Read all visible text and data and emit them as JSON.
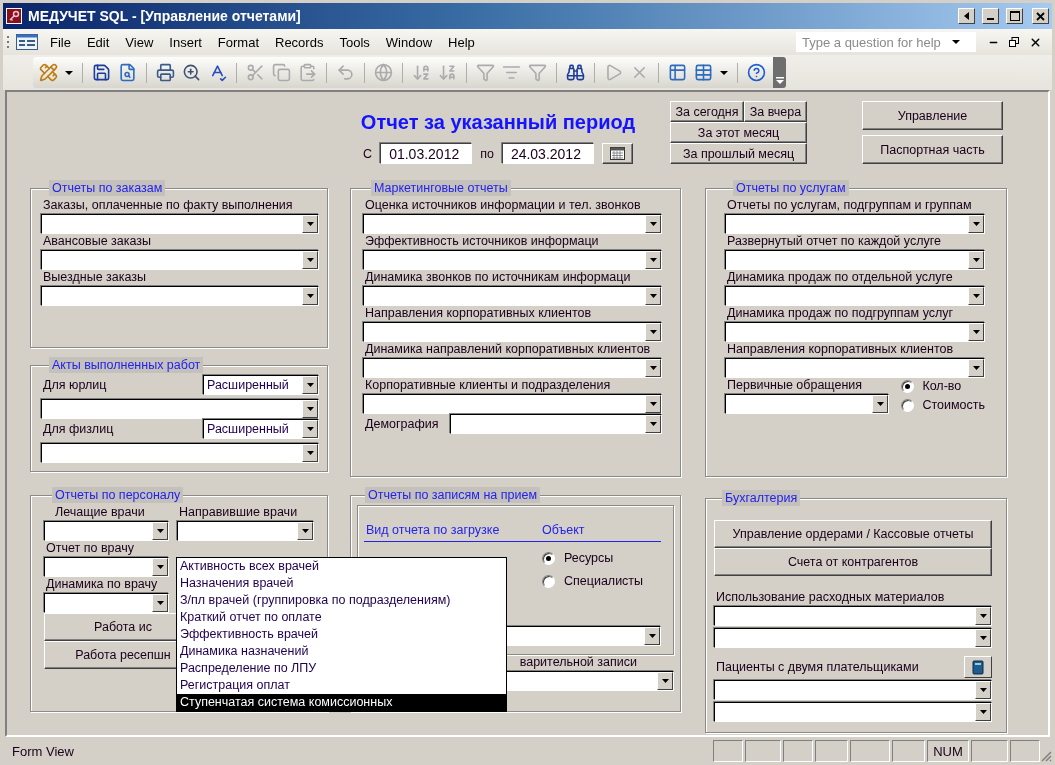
{
  "window": {
    "title": "МЕДУЧЕТ SQL - [Управление отчетами]"
  },
  "menu": [
    "File",
    "Edit",
    "View",
    "Insert",
    "Format",
    "Records",
    "Tools",
    "Window",
    "Help"
  ],
  "help_box": {
    "placeholder": "Type a question for help"
  },
  "toolbar": [
    {
      "disabled": false
    },
    {
      "disabled": false
    },
    {
      "disabled": false
    },
    {
      "disabled": false
    },
    {
      "disabled": false
    },
    {
      "disabled": false
    },
    {
      "disabled": true
    },
    {
      "disabled": true
    },
    {
      "disabled": true
    },
    {
      "disabled": true
    },
    {
      "disabled": true
    },
    {
      "disabled": true
    },
    {
      "disabled": true
    },
    {
      "disabled": true
    },
    {
      "disabled": true
    },
    {
      "disabled": true
    },
    {
      "disabled": false
    },
    {
      "disabled": true
    },
    {
      "disabled": true
    },
    {
      "disabled": false
    },
    {
      "disabled": false
    },
    {
      "disabled": false
    }
  ],
  "form": {
    "title": "Отчет за указанный период",
    "period": {
      "from_label": "С",
      "from": "01.03.2012",
      "to_label": "по",
      "to": "24.03.2012"
    },
    "quick_buttons": [
      "За сегодня",
      "За вчера",
      "За этот месяц",
      "За прошлый месяц"
    ],
    "side_buttons": [
      "Управление",
      "Паспортная часть"
    ],
    "columns": [
      [
        {
          "title": "Отчеты по заказам",
          "items": [
            {
              "kind": "field",
              "label": "Заказы, оплаченные по факту выполнения"
            },
            {
              "kind": "field",
              "label": "Авансовые заказы"
            },
            {
              "kind": "field",
              "label": "Выездные заказы"
            }
          ]
        },
        {
          "title": "Акты выполненных работ",
          "items": [
            {
              "kind": "option_field",
              "label": "Для юрлиц",
              "value": "Расширенный"
            },
            {
              "kind": "option_field",
              "label": "Для физлиц",
              "value": "Расширенный"
            }
          ]
        },
        {
          "title": "Отчеты по персоналу",
          "items": [
            {
              "kind": "pair",
              "fields": [
                {
                  "label": "Лечащие врачи"
                },
                {
                  "label": "Направившие врачи"
                }
              ]
            },
            {
              "kind": "short_field",
              "label": "Отчет по врачу"
            },
            {
              "kind": "short_field",
              "label": "Динамика по врачу"
            },
            {
              "kind": "buttons",
              "labels": [
                "Работа ис",
                "Работа ресепшн"
              ]
            }
          ]
        }
      ],
      [
        {
          "title": "Маркетинговые отчеты",
          "items": [
            {
              "kind": "field",
              "label": "Оценка источников информации и тел. звонков"
            },
            {
              "kind": "field",
              "label": "Эффективность источников информаци"
            },
            {
              "kind": "field",
              "label": "Динамика звонков по источникам информаци"
            },
            {
              "kind": "field",
              "label": "Направления корпоративных клиентов"
            },
            {
              "kind": "field",
              "label": "Динамика направлений корпоративных клиентов"
            },
            {
              "kind": "field",
              "label": "Корпоративные клиенты и подразделения"
            },
            {
              "kind": "inline_field",
              "label": "Демография"
            }
          ]
        },
        {
          "title": "Отчеты по записям на прием",
          "items": [
            {
              "kind": "radio_box",
              "columns": [
                {
                  "header": "Вид отчета по загрузке"
                },
                {
                  "header": "Объект",
                  "options": [
                    {
                      "label": "Ресурсы",
                      "selected": true
                    },
                    {
                      "label": "Специалисты",
                      "selected": false
                    }
                  ]
                }
              ]
            },
            {
              "kind": "field_right",
              "label": "варительной записи"
            }
          ]
        }
      ],
      [
        {
          "title": "Отчеты по услугам",
          "items": [
            {
              "kind": "field",
              "label": "Отчеты по услугам, подгруппам и группам"
            },
            {
              "kind": "field",
              "label": "Развернутый отчет по каждой услуге"
            },
            {
              "kind": "field",
              "label": "Динамика продаж по отдельной услуге"
            },
            {
              "kind": "field",
              "label": "Динамика продаж по подгруппам услуг"
            },
            {
              "kind": "field",
              "label": "Направления корпоративных клиентов"
            },
            {
              "kind": "radio_field",
              "label": "Первичные обращения",
              "options": [
                {
                  "label": "Кол-во",
                  "selected": true
                },
                {
                  "label": "Стоимость",
                  "selected": false
                }
              ]
            }
          ]
        },
        {
          "title": "Бухгалтерия",
          "items": [
            {
              "kind": "buttons",
              "labels": [
                "Управление ордерами / Кассовые отчеты",
                "Счета от контрагентов"
              ]
            },
            {
              "kind": "field",
              "label": "Использование расходных материалов"
            },
            {
              "kind": "combo"
            },
            {
              "kind": "icon_field",
              "label": "Пациенты с двумя плательщиками"
            },
            {
              "kind": "combo"
            },
            {
              "kind": "combo"
            }
          ]
        }
      ]
    ],
    "open_list": {
      "items": [
        {
          "label": "Активность всех врачей",
          "selected": false
        },
        {
          "label": "Назначения врачей",
          "selected": false
        },
        {
          "label": "З/пл врачей (группировка по подразделениям)",
          "selected": false
        },
        {
          "label": "Краткий отчет по оплате",
          "selected": false
        },
        {
          "label": "Эффективность врачей",
          "selected": false
        },
        {
          "label": "Динамика назначений",
          "selected": false
        },
        {
          "label": "Распределение по ЛПУ",
          "selected": false
        },
        {
          "label": "Регистрация оплат",
          "selected": false
        },
        {
          "label": "Ступенчатая система комиссионных",
          "selected": true
        }
      ]
    }
  },
  "status_bar": {
    "text": "Form View",
    "indicator": "NUM"
  }
}
